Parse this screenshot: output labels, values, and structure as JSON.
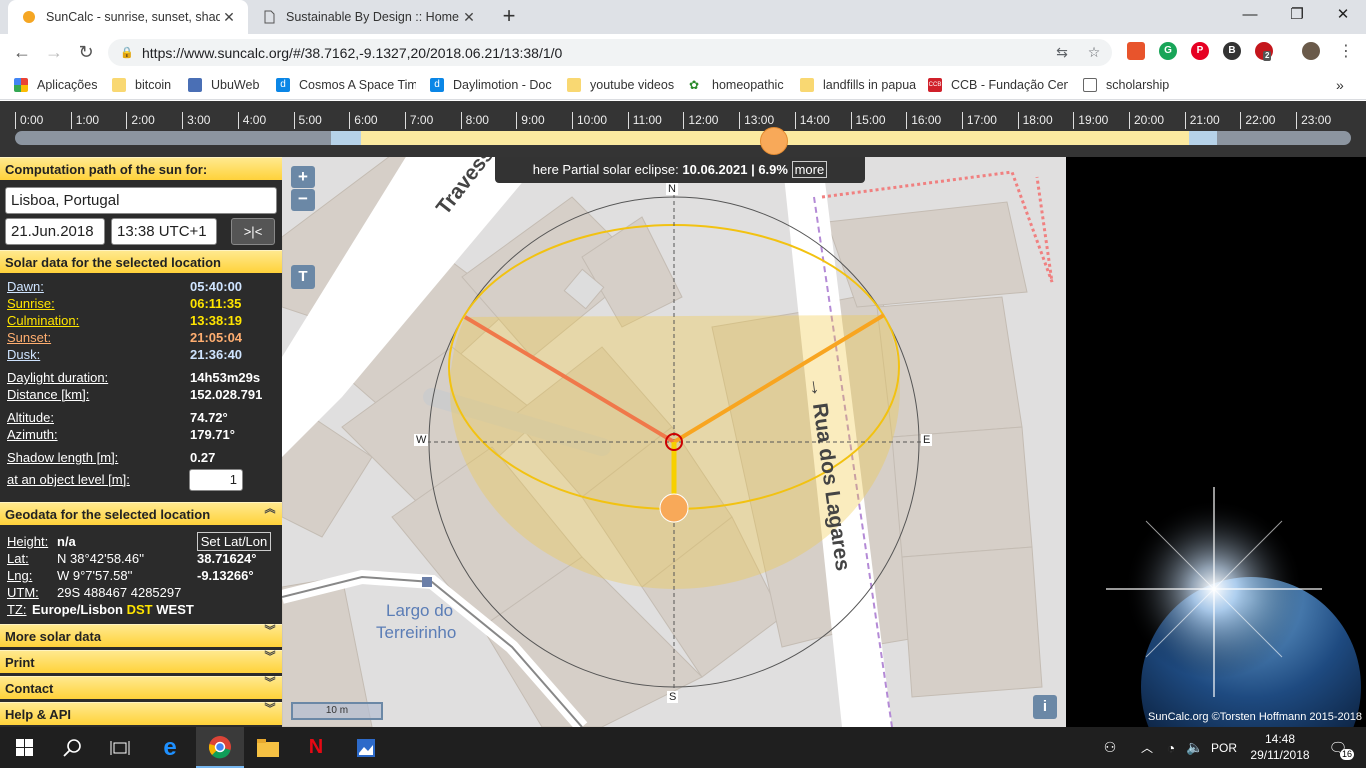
{
  "browser": {
    "tabs": [
      {
        "label": "SunCalc - sunrise, sunset, shadow",
        "active": true
      },
      {
        "label": "Sustainable By Design :: Home",
        "active": false
      }
    ],
    "url": "https://www.suncalc.org/#/38.7162,-9.1327,20/2018.06.21/13:38/1/0",
    "bookmarks": [
      "Aplicações",
      "bitcoin",
      "UbuWeb",
      "Cosmos A Space Time",
      "Daylimotion - Doc",
      "youtube videos",
      "homeopathic",
      "landfills in papua",
      "CCB - Fundação Cent",
      "scholarship"
    ],
    "extension_badge": "2"
  },
  "timeline": {
    "hours": [
      "0:00",
      "1:00",
      "2:00",
      "3:00",
      "4:00",
      "5:00",
      "6:00",
      "7:00",
      "8:00",
      "9:00",
      "10:00",
      "11:00",
      "12:00",
      "13:00",
      "14:00",
      "15:00",
      "16:00",
      "17:00",
      "18:00",
      "19:00",
      "20:00",
      "21:00",
      "22:00",
      "23:00"
    ],
    "selected_fraction": 0.5681
  },
  "panel": {
    "computation_title": "Computation path of the sun for:",
    "location": "Lisboa, Portugal",
    "date": "21.Jun.2018",
    "time": "13:38 UTC+1",
    "now_button": ">|<",
    "solar_title": "Solar data for the selected location",
    "solar": {
      "dawn_label": "Dawn:",
      "dawn": "05:40:00",
      "sunrise_label": "Sunrise:",
      "sunrise": "06:11:35",
      "culmination_label": "Culmination:",
      "culmination": "13:38:19",
      "sunset_label": "Sunset:",
      "sunset": "21:05:04",
      "dusk_label": "Dusk:",
      "dusk": "21:36:40",
      "daylight_label": "Daylight duration:",
      "daylight": "14h53m29s",
      "distance_label": "Distance [km]:",
      "distance": "152.028.791",
      "altitude_label": "Altitude:",
      "altitude": "74.72°",
      "azimuth_label": "Azimuth:",
      "azimuth": "179.71°",
      "shadow_label": "Shadow length [m]:",
      "shadow": "0.27",
      "object_label": "at an object level [m]:",
      "object_level": "1"
    },
    "geo_title": "Geodata for the selected location",
    "geo": {
      "height_label": "Height:",
      "height": "n/a",
      "set_button": "Set Lat/Lon",
      "lat_label": "Lat:",
      "lat_dms": "N 38°42'58.46''",
      "lat_dec": "38.71624°",
      "lng_label": "Lng:",
      "lng_dms": "W 9°7'57.58''",
      "lng_dec": "-9.13266°",
      "utm_label": "UTM:",
      "utm": "29S 488467 4285297",
      "tz_label": "TZ:",
      "tz": "Europe/Lisbon",
      "dst": "DST",
      "west": "WEST"
    },
    "more_solar": "More solar data",
    "print": "Print",
    "contact": "Contact",
    "help": "Help & API"
  },
  "map": {
    "eclipse_prefix": "here Partial solar eclipse:",
    "eclipse_info": "10.06.2021 | 6.9%",
    "more_button": "more",
    "zoom_in": "+",
    "zoom_out": "−",
    "t_button": "T",
    "info_button": "i",
    "scale": "10 m",
    "compass": {
      "n": "N",
      "s": "S",
      "e": "E",
      "w": "W"
    },
    "street1": "Travessa",
    "street2": "→ Rua dos Lagares",
    "place_line1": "Largo do",
    "place_line2": "Terreirinho"
  },
  "credit": "SunCalc.org ©Torsten Hoffmann 2015-2018",
  "taskbar": {
    "lang": "POR",
    "time": "14:48",
    "date": "29/11/2018",
    "notifications": "16"
  },
  "colors": {
    "accent_yellow": "#ffd23a",
    "sunrise_line": "#f0784a",
    "sunset_line": "#f8a520",
    "sun": "#f8a959"
  }
}
